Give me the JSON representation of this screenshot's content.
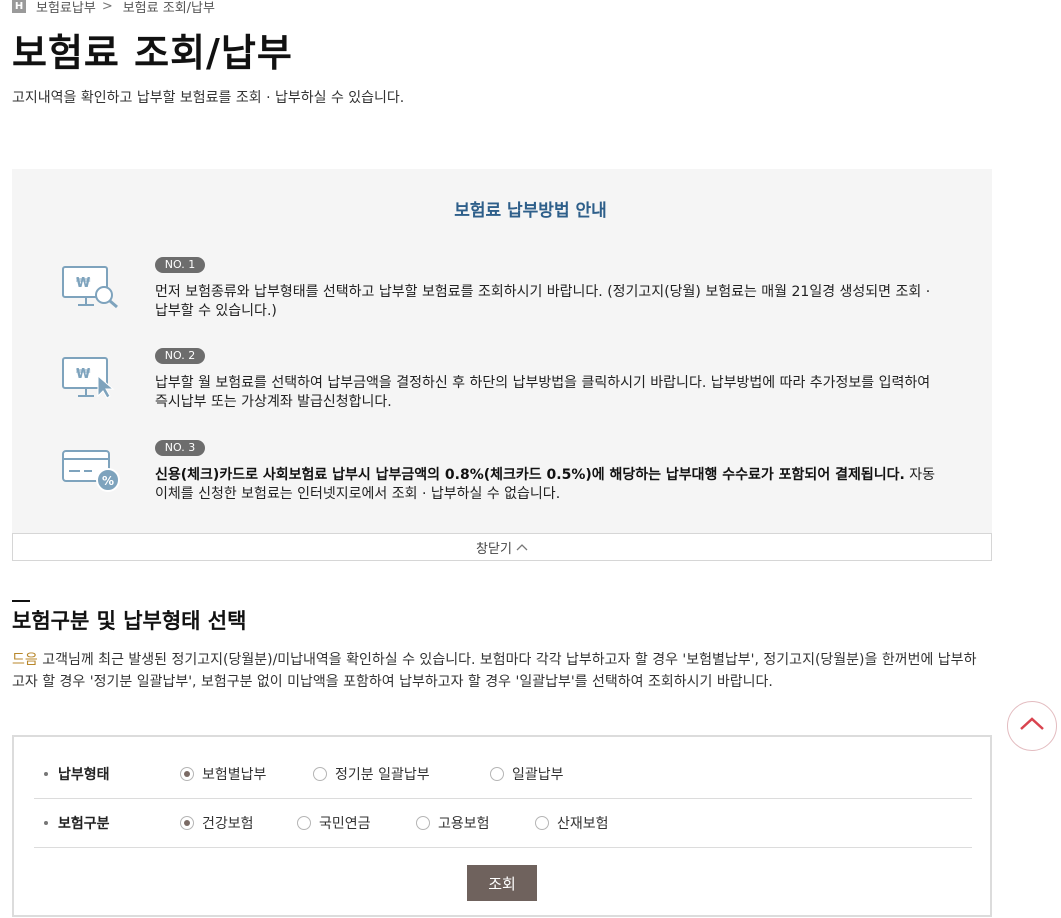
{
  "breadcrumb": {
    "home_icon": "H",
    "parent": "보험료납부",
    "separator": ">",
    "current": "보험료 조회/납부"
  },
  "header": {
    "title": "보험료 조회/납부",
    "description": "고지내역을 확인하고 납부할 보험료를 조회 · 납부하실 수 있습니다."
  },
  "guide": {
    "title": "보험료 납부방법 안내",
    "steps": [
      {
        "badge": "NO. 1",
        "icon": "monitor-won-search-icon",
        "text": "먼저 보험종류와 납부형태를 선택하고 납부할 보험료를 조회하시기 바랍니다. (정기고지(당월) 보험료는 매월 21일경 생성되면 조회 · 납부할 수 있습니다.)"
      },
      {
        "badge": "NO. 2",
        "icon": "monitor-won-cursor-icon",
        "text": "납부할 월 보험료를 선택하여 납부금액을 결정하신 후 하단의 납부방법을 클릭하시기 바랍니다. 납부방법에 따라 추가정보를 입력하여 즉시납부 또는 가상계좌 발급신청합니다."
      },
      {
        "badge": "NO. 3",
        "icon": "card-percent-icon",
        "text_bold": "신용(체크)카드로 사회보험료 납부시 납부금액의 0.8%(체크카드 0.5%)에 해당하는 납부대행 수수료가 포함되어 결제됩니다.",
        "text": " 자동이체를 신청한 보험료는 인터넷지로에서 조회 · 납부하실 수 없습니다."
      }
    ],
    "close_label": "창닫기"
  },
  "selection": {
    "title": "보험구분 및 납부형태 선택",
    "user_name": "드음",
    "description": " 고객님께 최근 발생된 정기고지(당월분)/미납내역을 확인하실 수 있습니다. 보험마다 각각 납부하고자 할 경우 '보험별납부', 정기고지(당월분)을 한꺼번에 납부하고자 할 경우 '정기분 일괄납부', 보험구분 없이 미납액을 포함하여 납부하고자 할 경우 '일괄납부'를 선택하여 조회하시기 바랍니다.",
    "payment_type": {
      "label": "납부형태",
      "options": [
        "보험별납부",
        "정기분 일괄납부",
        "일괄납부"
      ],
      "selected": "보험별납부"
    },
    "insurance_type": {
      "label": "보험구분",
      "options": [
        "건강보험",
        "국민연금",
        "고용보험",
        "산재보험"
      ],
      "selected": "건강보험"
    },
    "search_label": "조회"
  },
  "colors": {
    "guide_title": "#2e5f8a",
    "badge": "#6d6d6d",
    "icon": "#7ea3bd",
    "button": "#6f625d",
    "accent_name": "#b8872b",
    "top_arrow": "#d9444f"
  }
}
